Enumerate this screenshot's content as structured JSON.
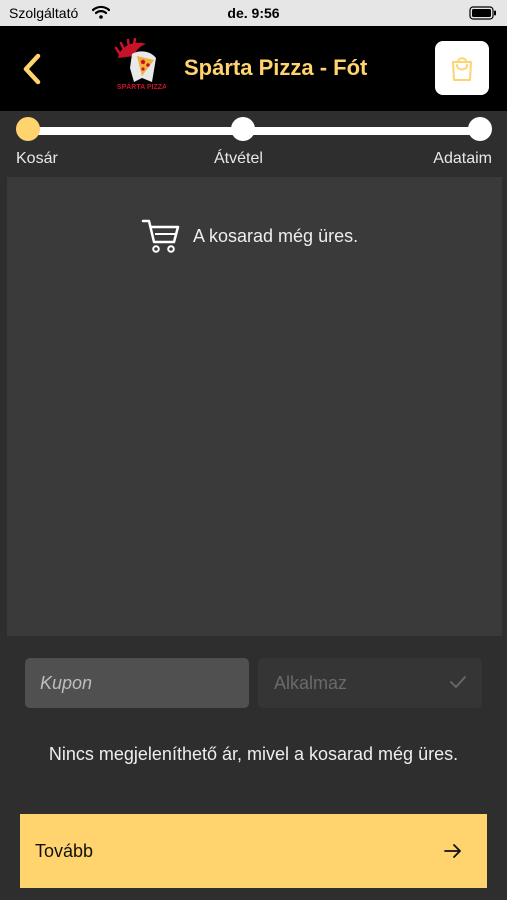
{
  "status_bar": {
    "carrier": "Szolgáltató",
    "time": "de. 9:56"
  },
  "header": {
    "title": "Spárta Pizza - Fót",
    "logo_text": "SPÁRTA PIZZA"
  },
  "stepper": {
    "steps": [
      {
        "label": "Kosár",
        "active": true
      },
      {
        "label": "Átvétel",
        "active": false
      },
      {
        "label": "Adataim",
        "active": false
      }
    ]
  },
  "cart": {
    "empty_message": "A kosarad még üres."
  },
  "coupon": {
    "placeholder": "Kupon",
    "apply_label": "Alkalmaz"
  },
  "price_note": "Nincs megjeleníthető ár, mivel a kosarad még üres.",
  "next": {
    "label": "Tovább"
  },
  "colors": {
    "accent": "#ffd36e",
    "background": "#2e2e2e",
    "panel": "#3a3a3a",
    "header": "#000000"
  }
}
